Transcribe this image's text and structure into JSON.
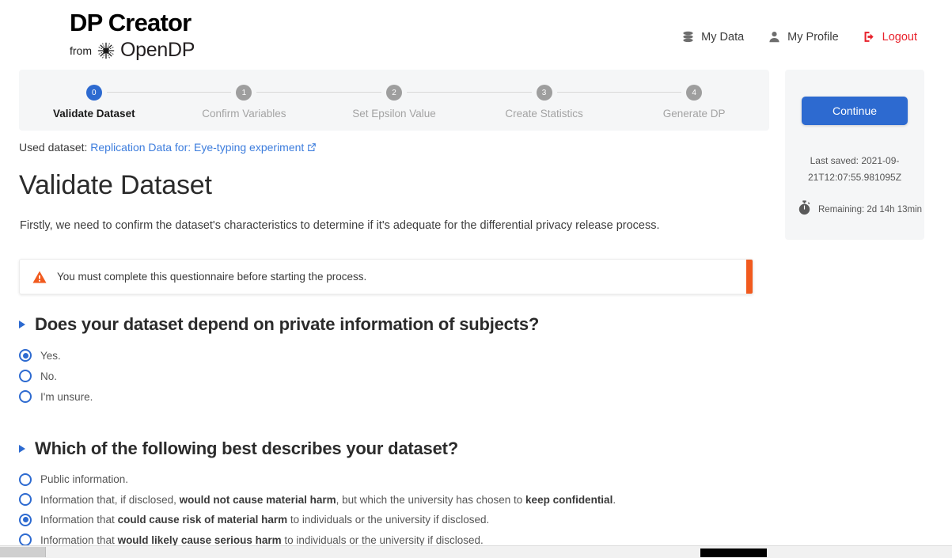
{
  "header": {
    "logo_title": "DP Creator",
    "logo_from": "from",
    "logo_org": "OpenDP",
    "logo_icon": "starburst-icon",
    "nav": [
      {
        "label": "My Data",
        "icon": "database-icon"
      },
      {
        "label": "My Profile",
        "icon": "person-icon"
      },
      {
        "label": "Logout",
        "icon": "logout-icon",
        "color": "#e8212b"
      }
    ]
  },
  "stepper": {
    "active_index": 0,
    "steps": [
      {
        "number": "0",
        "label": "Validate Dataset"
      },
      {
        "number": "1",
        "label": "Confirm Variables"
      },
      {
        "number": "2",
        "label": "Set Epsilon Value"
      },
      {
        "number": "3",
        "label": "Create Statistics"
      },
      {
        "number": "4",
        "label": "Generate DP"
      }
    ]
  },
  "main": {
    "used_dataset_label": "Used dataset:",
    "used_dataset_name": "Replication Data for: Eye-typing experiment",
    "used_dataset_icon": "external-link-icon",
    "page_title": "Validate Dataset",
    "intro": "Firstly, we need to confirm the dataset's characteristics to determine if it's adequate for the differential privacy release process.",
    "alert": {
      "icon": "warning-triangle-icon",
      "text": "You must complete this questionnaire before starting the process.",
      "accent_color": "#f15a1e"
    },
    "questions": [
      {
        "title": "Does your dataset depend on private information of subjects?",
        "selected_index": 0,
        "options": [
          {
            "html": "Yes."
          },
          {
            "html": "No."
          },
          {
            "html": "I'm unsure."
          }
        ]
      },
      {
        "title": "Which of the following best describes your dataset?",
        "selected_index": 2,
        "options": [
          {
            "html": "Public information."
          },
          {
            "html": "Information that, if disclosed, <b>would not cause material harm</b>, but which the university has chosen to <b>keep confidential</b>."
          },
          {
            "html": "Information that <b>could cause risk of material harm</b> to individuals or the university if disclosed."
          },
          {
            "html": "Information that <b>would likely cause serious harm</b> to individuals or the university if disclosed."
          }
        ]
      }
    ]
  },
  "side_panel": {
    "continue_label": "Continue",
    "last_saved": "Last saved: 2021-09-21T12:07:55.981095Z",
    "timer_icon": "stopwatch-icon",
    "remaining": "Remaining: 2d 14h 13min"
  },
  "colors": {
    "accent_blue": "#2d6ad0",
    "warning_orange": "#f15a1e",
    "logout_red": "#e8212b",
    "panel_gray": "#f5f6f7"
  }
}
